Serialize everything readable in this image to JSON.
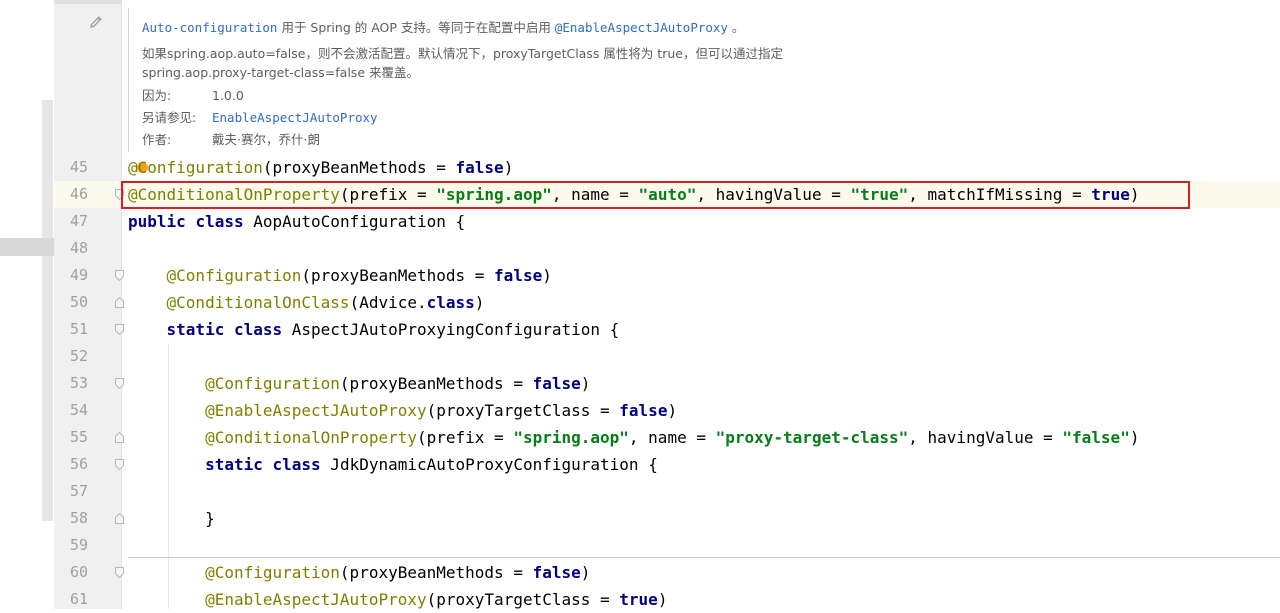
{
  "doc": {
    "summary_link": "Auto-configuration",
    "summary_text": " 用于 Spring 的 AOP 支持。等同于在配置中启用 ",
    "summary_link2": "@EnableAspectJAutoProxy",
    "summary_end": " 。",
    "desc_line1": "如果spring.aop.auto=false，则不会激活配置。默认情况下，proxyTargetClass 属性将为 true，但可以通过指定",
    "desc_line2": "spring.aop.proxy-target-class=false 来覆盖。",
    "since_label": "因为:",
    "since_value": "1.0.0",
    "see_label": "另请参见:",
    "see_value": "EnableAspectJAutoProxy",
    "author_label": "作者:",
    "author_value": "戴夫·赛尔，乔什·朗"
  },
  "lines": [
    {
      "n": "45"
    },
    {
      "n": "46"
    },
    {
      "n": "47"
    },
    {
      "n": "48"
    },
    {
      "n": "49"
    },
    {
      "n": "50"
    },
    {
      "n": "51"
    },
    {
      "n": "52"
    },
    {
      "n": "53"
    },
    {
      "n": "54"
    },
    {
      "n": "55"
    },
    {
      "n": "56"
    },
    {
      "n": "57"
    },
    {
      "n": "58"
    },
    {
      "n": "59"
    },
    {
      "n": "60"
    },
    {
      "n": "61"
    }
  ],
  "tokens": {
    "configuration": "@Configuration",
    "conditional_on_property": "@ConditionalOnProperty",
    "conditional_on_class": "@ConditionalOnClass",
    "enable_aspectj": "@EnableAspectJAutoProxy",
    "proxy_bean_methods": "(proxyBeanMethods = ",
    "false": "false",
    "true": "true",
    "close_paren": ")",
    "prefix_open": "(prefix = ",
    "spring_aop": "\"spring.aop\"",
    "name_eq": ", name = ",
    "auto": "\"auto\"",
    "having_value": ", havingValue = ",
    "true_str": "\"true\"",
    "match_if_missing": ", matchIfMissing = ",
    "public": "public",
    "class": "class",
    "static": "static",
    "aop_class_name": " AopAutoConfiguration {",
    "advice_open": "(Advice.",
    "aspectj_class_name": " AspectJAutoProxyingConfiguration {",
    "proxy_target_class": "(proxyTargetClass = ",
    "proxy_target_class_str": "\"proxy-target-class\"",
    "false_str": "\"false\"",
    "jdk_class_name": " JdkDynamicAutoProxyConfiguration {",
    "close_brace": "}"
  }
}
